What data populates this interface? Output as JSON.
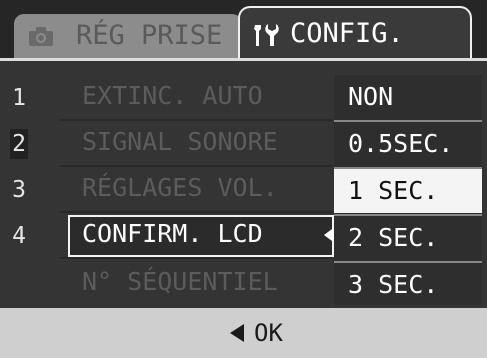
{
  "tabs": {
    "inactive": {
      "label": "RÉG PRISE",
      "icon": "camera-icon"
    },
    "active": {
      "label": "CONFIG.",
      "icon": "wrench-screwdriver-icon"
    }
  },
  "menu": {
    "items": [
      {
        "number": "1",
        "label": "EXTINC. AUTO",
        "state": "dimmed"
      },
      {
        "number": "2",
        "label": "SIGNAL SONORE",
        "state": "dimmed"
      },
      {
        "number": "3",
        "label": "RÉGLAGES VOL.",
        "state": "dimmed"
      },
      {
        "number": "4",
        "label": "CONFIRM. LCD",
        "state": "selected"
      },
      {
        "number": "",
        "label": "N° SÉQUENTIEL",
        "state": "dimmed"
      }
    ],
    "highlighted_page": "2"
  },
  "dropdown": {
    "options": [
      "NON",
      "0.5SEC.",
      "1 SEC.",
      "2 SEC.",
      "3 SEC."
    ],
    "selected_value": "1 SEC.",
    "pointer_icon": "left-triangle-icon"
  },
  "footer": {
    "ok_label": "OK",
    "arrow_icon": "left-arrow-icon"
  },
  "colors": {
    "background": "#343434",
    "selected_option_bg": "#f4f4f4",
    "footer_bg": "#cfcfcf"
  }
}
